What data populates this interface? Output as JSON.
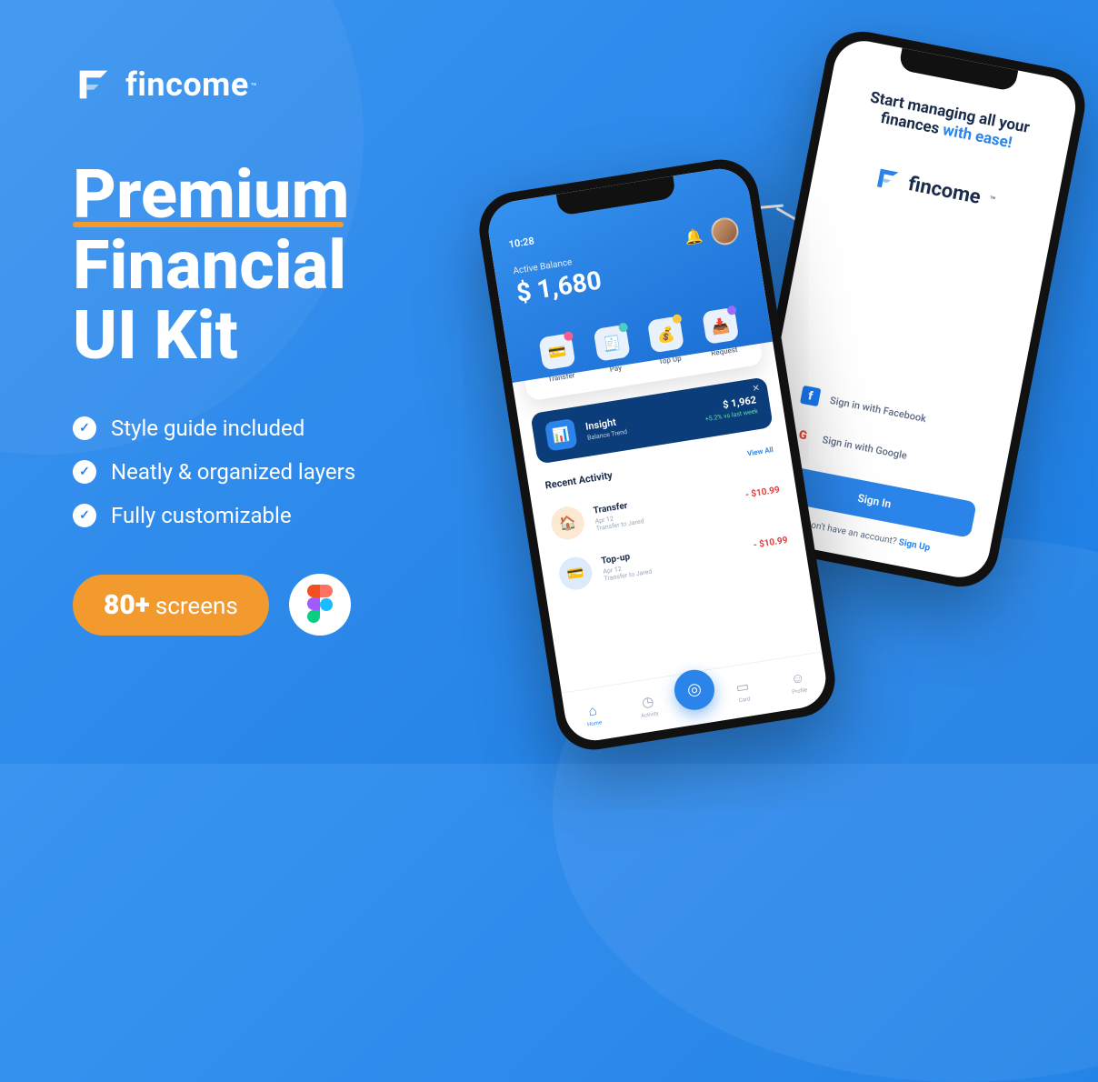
{
  "brand": {
    "name": "fincome",
    "tm": "™"
  },
  "hero": {
    "title_word1": "Premium",
    "title_word2": "Financial",
    "title_word3": "UI Kit"
  },
  "features": [
    "Style guide included",
    "Neatly & organized layers",
    "Fully customizable"
  ],
  "badge": {
    "count": "80+",
    "label": "screens"
  },
  "phone_welcome": {
    "title_a": "Start managing all your",
    "title_b": "finances ",
    "title_accent": "with ease!",
    "logo": "fincome",
    "facebook": "Sign in with Facebook",
    "google": "Sign in with Google",
    "signin": "Sign In",
    "signup_a": "Don't have an account? ",
    "signup_b": "Sign Up"
  },
  "phone_home": {
    "time": "10:28",
    "balance_label": "Active Balance",
    "balance": "$ 1,680",
    "actions": [
      {
        "label": "Transfer",
        "dot": "#ff5a8a"
      },
      {
        "label": "Pay",
        "dot": "#4ecdc4"
      },
      {
        "label": "Top Up",
        "dot": "#f9c846"
      },
      {
        "label": "Request",
        "dot": "#9a6bff"
      }
    ],
    "insight": {
      "title": "Insight",
      "sub": "Balance Trend",
      "amount": "$ 1,962",
      "pct": "+5.2% vs last week"
    },
    "recent_title": "Recent Activity",
    "view_all": "View All",
    "recent": [
      {
        "title": "Transfer",
        "date": "Apr 12",
        "sub": "Transfer to Jared",
        "amount": "- $10.99",
        "color": "orange"
      },
      {
        "title": "Top-up",
        "date": "Apr 12",
        "sub": "Transfer to Jared",
        "amount": "- $10.99",
        "color": "blue"
      }
    ],
    "tabs": [
      "Home",
      "Activity",
      "",
      "Card",
      "Profile"
    ]
  }
}
